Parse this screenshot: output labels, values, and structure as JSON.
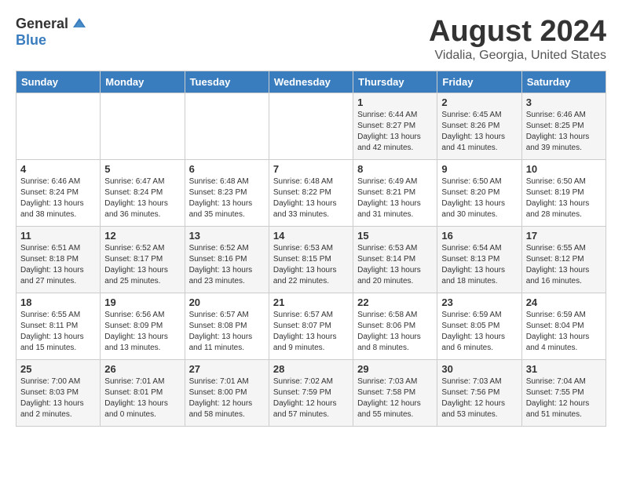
{
  "header": {
    "logo_general": "General",
    "logo_blue": "Blue",
    "month_title": "August 2024",
    "location": "Vidalia, Georgia, United States"
  },
  "weekdays": [
    "Sunday",
    "Monday",
    "Tuesday",
    "Wednesday",
    "Thursday",
    "Friday",
    "Saturday"
  ],
  "weeks": [
    [
      {
        "day": "",
        "info": ""
      },
      {
        "day": "",
        "info": ""
      },
      {
        "day": "",
        "info": ""
      },
      {
        "day": "",
        "info": ""
      },
      {
        "day": "1",
        "info": "Sunrise: 6:44 AM\nSunset: 8:27 PM\nDaylight: 13 hours\nand 42 minutes."
      },
      {
        "day": "2",
        "info": "Sunrise: 6:45 AM\nSunset: 8:26 PM\nDaylight: 13 hours\nand 41 minutes."
      },
      {
        "day": "3",
        "info": "Sunrise: 6:46 AM\nSunset: 8:25 PM\nDaylight: 13 hours\nand 39 minutes."
      }
    ],
    [
      {
        "day": "4",
        "info": "Sunrise: 6:46 AM\nSunset: 8:24 PM\nDaylight: 13 hours\nand 38 minutes."
      },
      {
        "day": "5",
        "info": "Sunrise: 6:47 AM\nSunset: 8:24 PM\nDaylight: 13 hours\nand 36 minutes."
      },
      {
        "day": "6",
        "info": "Sunrise: 6:48 AM\nSunset: 8:23 PM\nDaylight: 13 hours\nand 35 minutes."
      },
      {
        "day": "7",
        "info": "Sunrise: 6:48 AM\nSunset: 8:22 PM\nDaylight: 13 hours\nand 33 minutes."
      },
      {
        "day": "8",
        "info": "Sunrise: 6:49 AM\nSunset: 8:21 PM\nDaylight: 13 hours\nand 31 minutes."
      },
      {
        "day": "9",
        "info": "Sunrise: 6:50 AM\nSunset: 8:20 PM\nDaylight: 13 hours\nand 30 minutes."
      },
      {
        "day": "10",
        "info": "Sunrise: 6:50 AM\nSunset: 8:19 PM\nDaylight: 13 hours\nand 28 minutes."
      }
    ],
    [
      {
        "day": "11",
        "info": "Sunrise: 6:51 AM\nSunset: 8:18 PM\nDaylight: 13 hours\nand 27 minutes."
      },
      {
        "day": "12",
        "info": "Sunrise: 6:52 AM\nSunset: 8:17 PM\nDaylight: 13 hours\nand 25 minutes."
      },
      {
        "day": "13",
        "info": "Sunrise: 6:52 AM\nSunset: 8:16 PM\nDaylight: 13 hours\nand 23 minutes."
      },
      {
        "day": "14",
        "info": "Sunrise: 6:53 AM\nSunset: 8:15 PM\nDaylight: 13 hours\nand 22 minutes."
      },
      {
        "day": "15",
        "info": "Sunrise: 6:53 AM\nSunset: 8:14 PM\nDaylight: 13 hours\nand 20 minutes."
      },
      {
        "day": "16",
        "info": "Sunrise: 6:54 AM\nSunset: 8:13 PM\nDaylight: 13 hours\nand 18 minutes."
      },
      {
        "day": "17",
        "info": "Sunrise: 6:55 AM\nSunset: 8:12 PM\nDaylight: 13 hours\nand 16 minutes."
      }
    ],
    [
      {
        "day": "18",
        "info": "Sunrise: 6:55 AM\nSunset: 8:11 PM\nDaylight: 13 hours\nand 15 minutes."
      },
      {
        "day": "19",
        "info": "Sunrise: 6:56 AM\nSunset: 8:09 PM\nDaylight: 13 hours\nand 13 minutes."
      },
      {
        "day": "20",
        "info": "Sunrise: 6:57 AM\nSunset: 8:08 PM\nDaylight: 13 hours\nand 11 minutes."
      },
      {
        "day": "21",
        "info": "Sunrise: 6:57 AM\nSunset: 8:07 PM\nDaylight: 13 hours\nand 9 minutes."
      },
      {
        "day": "22",
        "info": "Sunrise: 6:58 AM\nSunset: 8:06 PM\nDaylight: 13 hours\nand 8 minutes."
      },
      {
        "day": "23",
        "info": "Sunrise: 6:59 AM\nSunset: 8:05 PM\nDaylight: 13 hours\nand 6 minutes."
      },
      {
        "day": "24",
        "info": "Sunrise: 6:59 AM\nSunset: 8:04 PM\nDaylight: 13 hours\nand 4 minutes."
      }
    ],
    [
      {
        "day": "25",
        "info": "Sunrise: 7:00 AM\nSunset: 8:03 PM\nDaylight: 13 hours\nand 2 minutes."
      },
      {
        "day": "26",
        "info": "Sunrise: 7:01 AM\nSunset: 8:01 PM\nDaylight: 13 hours\nand 0 minutes."
      },
      {
        "day": "27",
        "info": "Sunrise: 7:01 AM\nSunset: 8:00 PM\nDaylight: 12 hours\nand 58 minutes."
      },
      {
        "day": "28",
        "info": "Sunrise: 7:02 AM\nSunset: 7:59 PM\nDaylight: 12 hours\nand 57 minutes."
      },
      {
        "day": "29",
        "info": "Sunrise: 7:03 AM\nSunset: 7:58 PM\nDaylight: 12 hours\nand 55 minutes."
      },
      {
        "day": "30",
        "info": "Sunrise: 7:03 AM\nSunset: 7:56 PM\nDaylight: 12 hours\nand 53 minutes."
      },
      {
        "day": "31",
        "info": "Sunrise: 7:04 AM\nSunset: 7:55 PM\nDaylight: 12 hours\nand 51 minutes."
      }
    ]
  ]
}
